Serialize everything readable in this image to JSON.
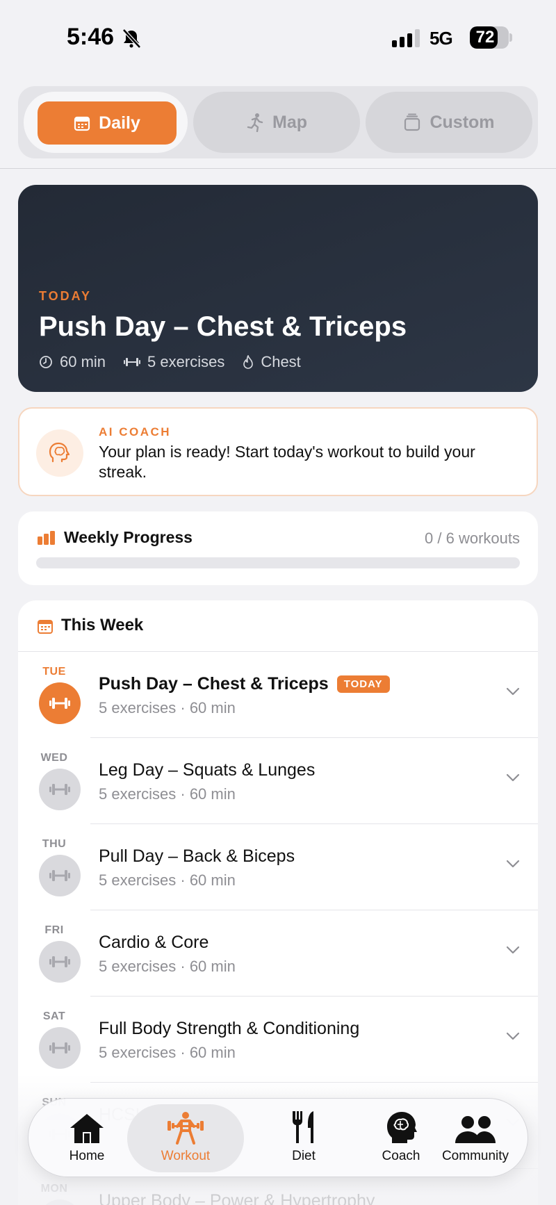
{
  "status_bar": {
    "time": "5:46",
    "network": "5G",
    "battery": "72",
    "battery_level": 0.72
  },
  "segments": [
    {
      "label": "Daily",
      "icon": "calendar-icon",
      "active": true
    },
    {
      "label": "Map",
      "icon": "running-icon",
      "active": false
    },
    {
      "label": "Custom",
      "icon": "stack-icon",
      "active": false
    }
  ],
  "hero": {
    "kicker": "TODAY",
    "title": "Push Day – Chest & Triceps",
    "duration": "60 min",
    "exercises": "5 exercises",
    "muscle": "Chest"
  },
  "coach": {
    "kicker": "AI COACH",
    "message": "Your plan is ready! Start today's workout to build your streak."
  },
  "progress": {
    "title": "Weekly Progress",
    "count": "0 / 6 workouts",
    "value": 0
  },
  "week": {
    "title": "This Week",
    "today_badge": "TODAY",
    "days": [
      {
        "day": "TUE",
        "title": "Push Day – Chest & Triceps",
        "sub": "5 exercises · 60 min",
        "today": true
      },
      {
        "day": "WED",
        "title": "Leg Day – Squats & Lunges",
        "sub": "5 exercises · 60 min",
        "today": false
      },
      {
        "day": "THU",
        "title": "Pull Day – Back & Biceps",
        "sub": "5 exercises · 60 min",
        "today": false
      },
      {
        "day": "FRI",
        "title": "Cardio & Core",
        "sub": "5 exercises · 60 min",
        "today": false
      },
      {
        "day": "SAT",
        "title": "Full Body Strength & Conditioning",
        "sub": "5 exercises · 60 min",
        "today": false
      },
      {
        "day": "SUN",
        "title": "HCSL",
        "sub": "",
        "today": false
      },
      {
        "day": "MON",
        "title": "Upper Body – Power & Hypertrophy",
        "sub": "",
        "today": false
      }
    ]
  },
  "tabs": [
    {
      "label": "Home",
      "icon": "home-icon",
      "active": false
    },
    {
      "label": "Workout",
      "icon": "weightlifter-icon",
      "active": true
    },
    {
      "label": "Diet",
      "icon": "fork-knife-icon",
      "active": false
    },
    {
      "label": "Coach",
      "icon": "brain-head-icon",
      "active": false
    },
    {
      "label": "Community",
      "icon": "people-icon",
      "active": false
    }
  ],
  "colors": {
    "accent": "#ec7d34",
    "hero_bg": "#232a36",
    "muted": "#8e8e93"
  }
}
